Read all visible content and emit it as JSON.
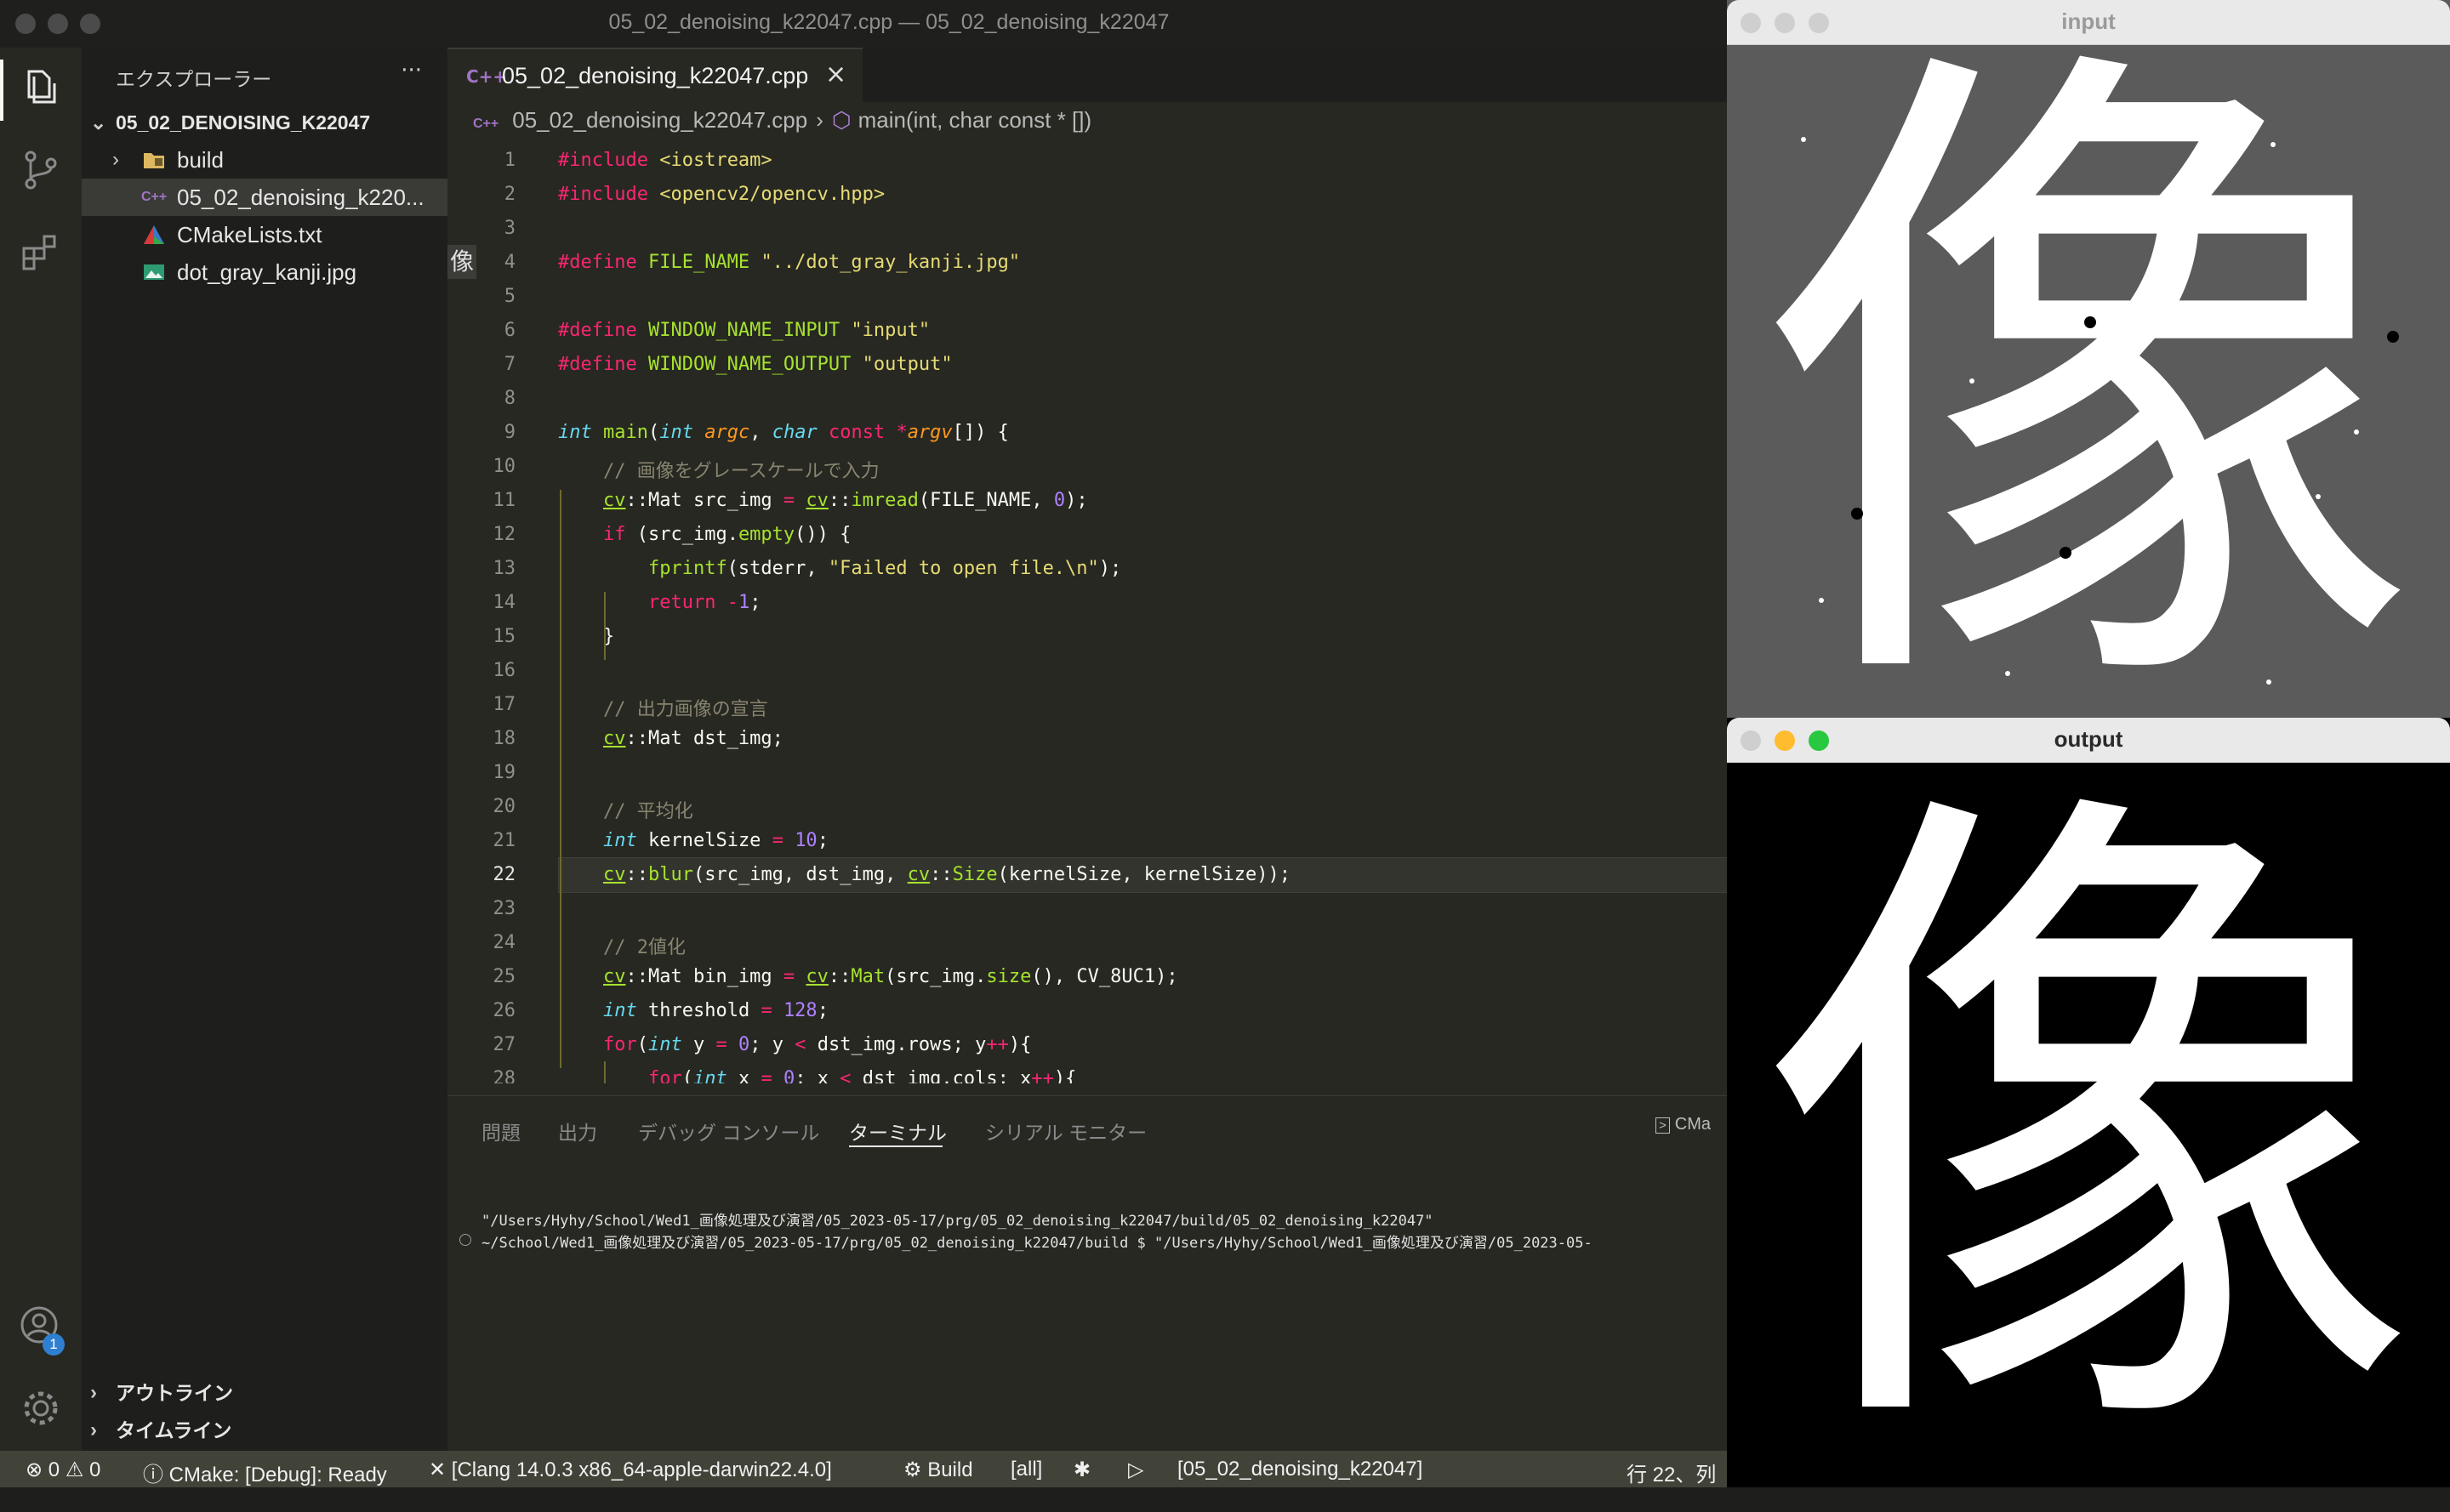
{
  "window_title": "05_02_denoising_k22047.cpp — 05_02_denoising_k22047",
  "explorer": {
    "header": "エクスプローラー",
    "more": "···",
    "root": "05_02_DENOISING_K22047",
    "items": [
      {
        "label": "build",
        "type": "folder"
      },
      {
        "label": "05_02_denoising_k220...",
        "type": "cpp"
      },
      {
        "label": "CMakeLists.txt",
        "type": "cmake"
      },
      {
        "label": "dot_gray_kanji.jpg",
        "type": "image"
      }
    ],
    "outline": "アウトライン",
    "timeline": "タイムライン",
    "badge": "1"
  },
  "editor": {
    "tab_label": "05_02_denoising_k22047.cpp",
    "tab_icon": "C++",
    "breadcrumb_file": "05_02_denoising_k22047.cpp",
    "breadcrumb_symbol": "main(int, char const * [])",
    "hover_char": "像",
    "current_line": 22,
    "line_numbers": [
      "1",
      "2",
      "3",
      "4",
      "5",
      "6",
      "7",
      "8",
      "9",
      "10",
      "11",
      "12",
      "13",
      "14",
      "15",
      "16",
      "17",
      "18",
      "19",
      "20",
      "21",
      "22",
      "23",
      "24",
      "25",
      "26",
      "27",
      "28"
    ],
    "code": [
      "#include <iostream>",
      "#include <opencv2/opencv.hpp>",
      "",
      "#define FILE_NAME \"../dot_gray_kanji.jpg\"",
      "",
      "#define WINDOW_NAME_INPUT \"input\"",
      "#define WINDOW_NAME_OUTPUT \"output\"",
      "",
      "int main(int argc, char const *argv[]) {",
      "    // 画像をグレースケールで入力",
      "    cv::Mat src_img = cv::imread(FILE_NAME, 0);",
      "    if (src_img.empty()) {",
      "        fprintf(stderr, \"Failed to open file.\\n\");",
      "        return -1;",
      "    }",
      "",
      "    // 出力画像の宣言",
      "    cv::Mat dst_img;",
      "",
      "    // 平均化",
      "    int kernelSize = 10;",
      "    cv::blur(src_img, dst_img, cv::Size(kernelSize, kernelSize));",
      "",
      "    // 2値化",
      "    cv::Mat bin_img = cv::Mat(src_img.size(), CV_8UC1);",
      "    int threshold = 128;",
      "    for(int y = 0; y < dst_img.rows; y++){",
      "        for(int x = 0; x < dst_img.cols; x++){"
    ]
  },
  "panel": {
    "tabs": [
      "問題",
      "出力",
      "デバッグ コンソール",
      "ターミナル",
      "シリアル モニター"
    ],
    "active_tab": "ターミナル",
    "terminal_chip": "CMa",
    "terminal_lines": [
      "\"/Users/Hyhy/School/Wed1_画像処理及び演習/05_2023-05-17/prg/05_02_denoising_k22047/build/05_02_denoising_k22047\"",
      "~/School/Wed1_画像処理及び演習/05_2023-05-17/prg/05_02_denoising_k22047/build $ \"/Users/Hyhy/School/Wed1_画像処理及び演習/05_2023-05-"
    ]
  },
  "status": {
    "errors": "0",
    "warnings": "0",
    "cmake": "CMake: [Debug]: Ready",
    "kit": "[Clang 14.0.3 x86_64-apple-darwin22.4.0]",
    "build": "Build",
    "target": "[all]",
    "launch": "[05_02_denoising_k22047]",
    "position": "行 22、列"
  },
  "windows": {
    "input": {
      "title": "input",
      "glyph": "像"
    },
    "output": {
      "title": "output",
      "glyph": "像"
    }
  },
  "colors": {
    "input_bg": "#5b5b5b",
    "output_bg": "#000000",
    "traffic_close": "#ff5f57",
    "traffic_min": "#febc2e",
    "traffic_max": "#28c840"
  }
}
